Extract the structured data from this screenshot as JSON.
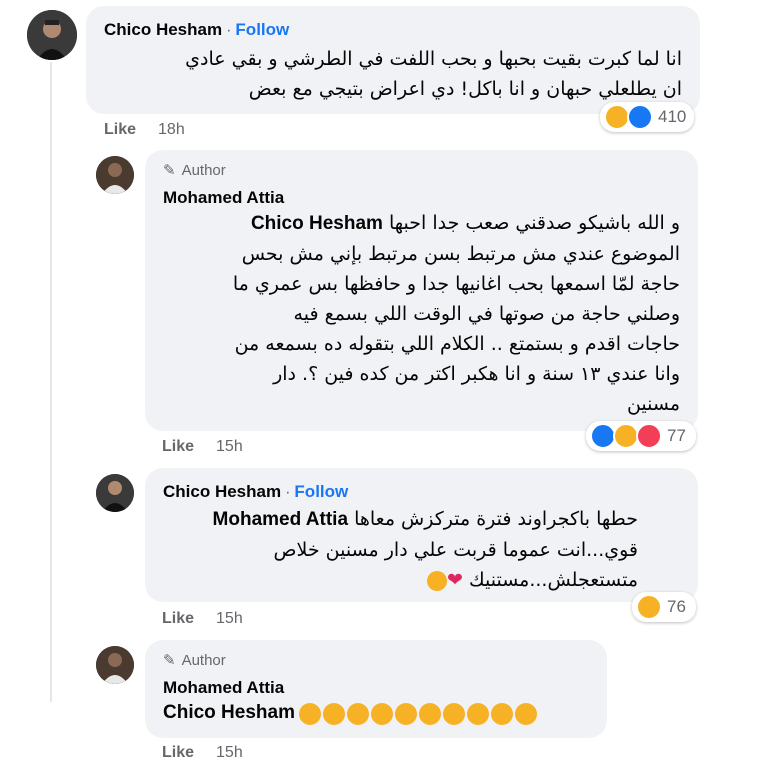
{
  "comment1": {
    "author": "Chico Hesham",
    "follow_label": "Follow",
    "text_line1": "انا لما كبرت بقيت بحبها و بحب اللفت في الطرشي و بقي عادي",
    "text_line2": "ان يطلعلي حبهان و انا باكل! دي اعراض بتيجي مع بعض",
    "like_label": "Like",
    "time": "18h",
    "reaction_count": "410"
  },
  "reply1": {
    "badge": "Author",
    "author": "Mohamed Attia",
    "tag": "Chico Hesham",
    "line1": "و الله باشيكو صدقني صعب جدا احبها",
    "line2": "الموضوع عندي مش مرتبط بسن مرتبط بإني مش بحس",
    "line3": "حاجة لمّا اسمعها بحب اغانيها جدا و حافظها بس عمري ما",
    "line4": "وصلني حاجة من صوتها في الوقت اللي بسمع فيه",
    "line5": "حاجات اقدم و بستمتع .. الكلام اللي بتقوله ده بسمعه من",
    "line6": "وانا عندي ١٣ سنة و انا هكبر اكتر من كده فين ؟. دار",
    "line7": "مسنين",
    "like_label": "Like",
    "time": "15h",
    "reaction_count": "77"
  },
  "reply2": {
    "author": "Chico Hesham",
    "follow_label": "Follow",
    "tag": "Mohamed Attia",
    "line1": "حطها باكجراوند فترة متركزش معاها",
    "line2": "قوي...انت عموما قربت علي دار مسنين خلاص",
    "line3": "متستعجلش...مستنيك",
    "like_label": "Like",
    "time": "15h",
    "reaction_count": "76"
  },
  "reply3": {
    "badge": "Author",
    "author": "Mohamed Attia",
    "tag": "Chico Hesham",
    "like_label": "Like",
    "time": "15h"
  },
  "colors": {
    "like_blue": "#1877f2",
    "haha_yellow": "#f7b125",
    "love_red": "#f33e58",
    "bubble": "#f0f2f5"
  }
}
